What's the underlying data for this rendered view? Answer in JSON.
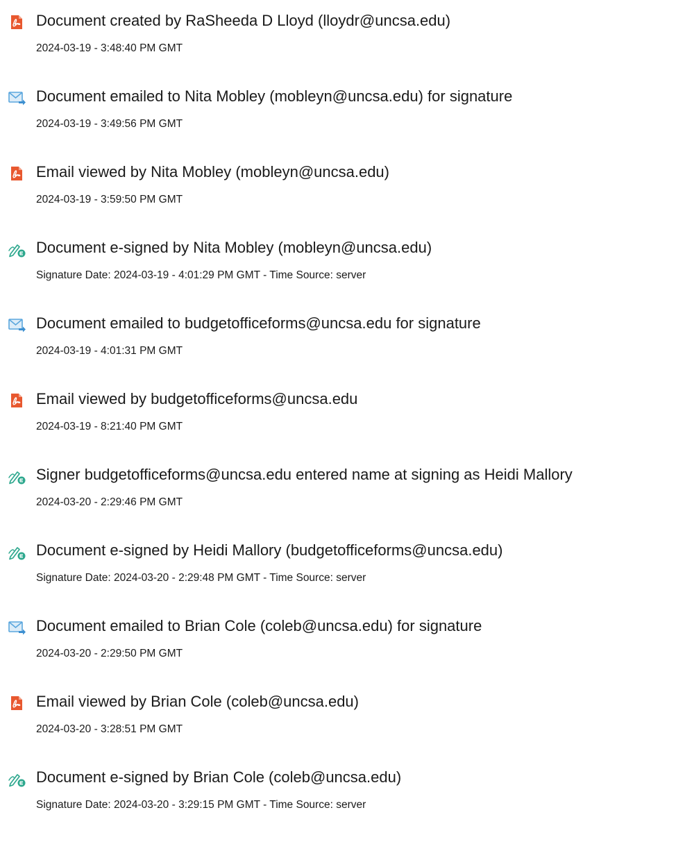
{
  "colors": {
    "acrobat_icon": "#e8582f",
    "email_icon": "#5aa6dd",
    "signature_icon": "#2ea88e",
    "text": "#1a1a1a"
  },
  "events": [
    {
      "icon": "acrobat-document-icon",
      "title": "Document created by RaSheeda D Lloyd (lloydr@uncsa.edu)",
      "detail": "2024-03-19 - 3:48:40 PM GMT"
    },
    {
      "icon": "email-sent-icon",
      "title": "Document emailed to Nita Mobley (mobleyn@uncsa.edu) for signature",
      "detail": "2024-03-19 - 3:49:56 PM GMT"
    },
    {
      "icon": "acrobat-document-icon",
      "title": "Email viewed by Nita Mobley (mobleyn@uncsa.edu)",
      "detail": "2024-03-19 - 3:59:50 PM GMT"
    },
    {
      "icon": "e-signature-pen-icon",
      "title": "Document e-signed by Nita Mobley (mobleyn@uncsa.edu)",
      "detail": "Signature Date: 2024-03-19 - 4:01:29 PM GMT - Time Source: server"
    },
    {
      "icon": "email-sent-icon",
      "title": "Document emailed to budgetofficeforms@uncsa.edu for signature",
      "detail": "2024-03-19 - 4:01:31 PM GMT"
    },
    {
      "icon": "acrobat-document-icon",
      "title": "Email viewed by budgetofficeforms@uncsa.edu",
      "detail": "2024-03-19 - 8:21:40 PM GMT"
    },
    {
      "icon": "e-signature-pen-icon",
      "title": "Signer budgetofficeforms@uncsa.edu entered name at signing as Heidi Mallory",
      "detail": "2024-03-20 - 2:29:46 PM GMT"
    },
    {
      "icon": "e-signature-pen-icon",
      "title": "Document e-signed by Heidi Mallory (budgetofficeforms@uncsa.edu)",
      "detail": "Signature Date: 2024-03-20 - 2:29:48 PM GMT - Time Source: server"
    },
    {
      "icon": "email-sent-icon",
      "title": "Document emailed to Brian Cole (coleb@uncsa.edu) for signature",
      "detail": "2024-03-20 - 2:29:50 PM GMT"
    },
    {
      "icon": "acrobat-document-icon",
      "title": "Email viewed by Brian Cole (coleb@uncsa.edu)",
      "detail": "2024-03-20 - 3:28:51 PM GMT"
    },
    {
      "icon": "e-signature-pen-icon",
      "title": "Document e-signed by Brian Cole (coleb@uncsa.edu)",
      "detail": "Signature Date: 2024-03-20 - 3:29:15 PM GMT - Time Source: server"
    }
  ]
}
